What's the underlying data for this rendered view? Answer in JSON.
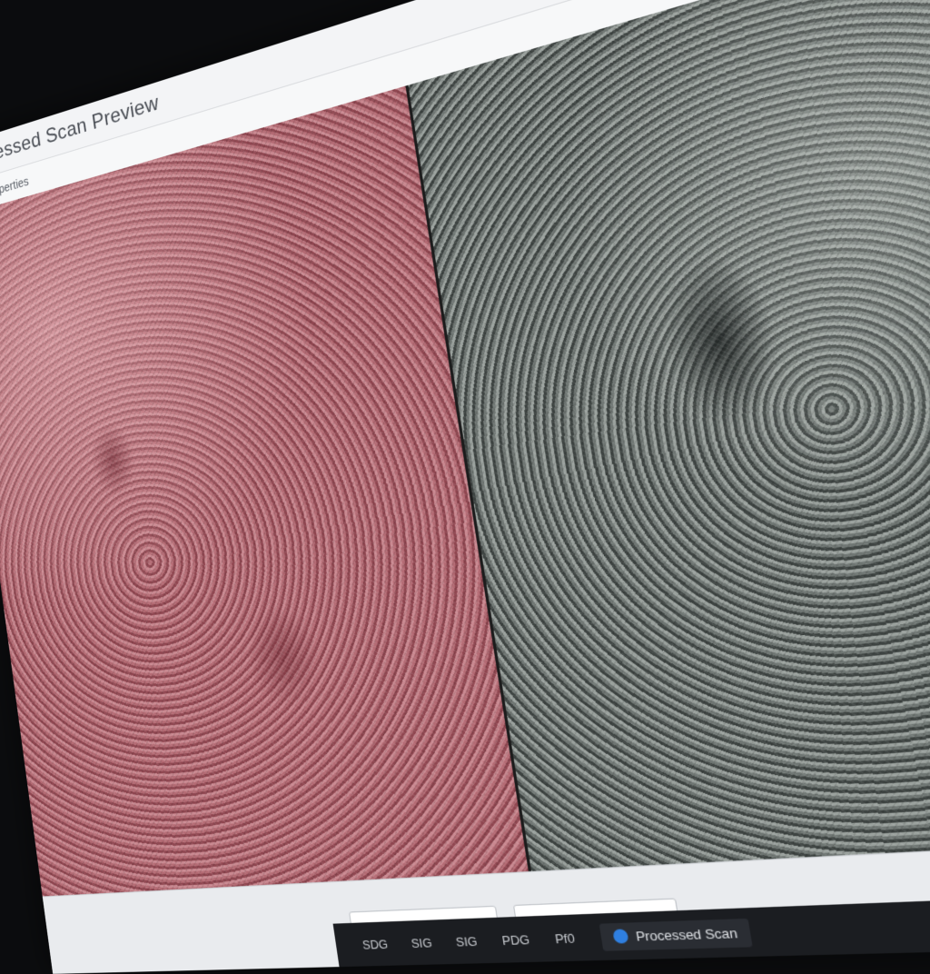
{
  "window": {
    "title": "Processed Scan Preview",
    "toolbar_label": "Properties"
  },
  "panels": {
    "left_color": "#a85b66",
    "right_color": "#575e5b"
  },
  "taskbar": {
    "items": [
      "SDG",
      "SIG",
      "SIG",
      "PDG",
      "Pf0"
    ],
    "app_label": "Processed Scan"
  },
  "icons": [
    "minimize-icon",
    "maximize-icon",
    "close-icon",
    "settings-icon"
  ]
}
